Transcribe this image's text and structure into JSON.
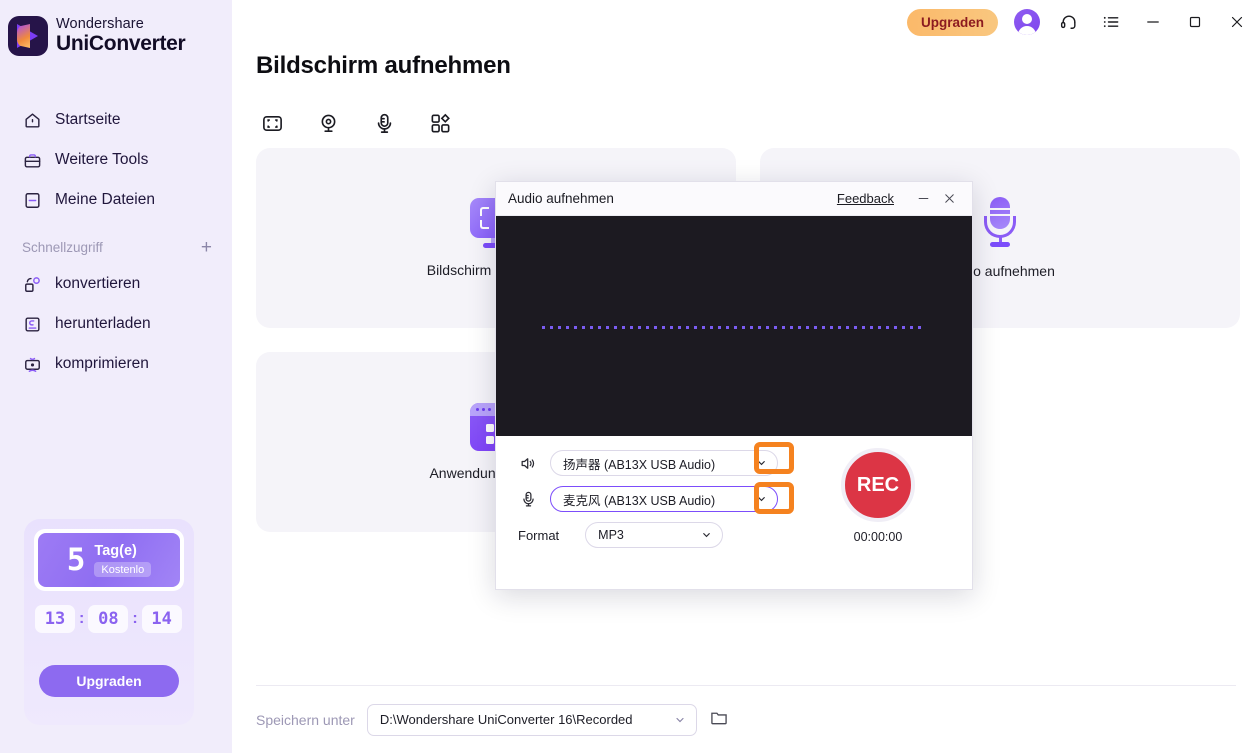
{
  "sidebar": {
    "brand": {
      "line1": "Wondershare",
      "line2": "UniConverter",
      "logo_icon": "play-logo-icon"
    },
    "items": [
      {
        "label": "Startseite",
        "icon": "home-icon"
      },
      {
        "label": "Weitere Tools",
        "icon": "toolbox-icon"
      },
      {
        "label": "Meine Dateien",
        "icon": "files-icon"
      }
    ],
    "quick_access": {
      "label": "Schnellzugriff",
      "add_icon": "plus-icon"
    },
    "quick_items": [
      {
        "label": "konvertieren",
        "icon": "convert-icon"
      },
      {
        "label": "herunterladen",
        "icon": "download-icon"
      },
      {
        "label": "komprimieren",
        "icon": "compress-icon"
      }
    ],
    "trial": {
      "days": "5",
      "days_label": "Tag(e)",
      "free_badge": "Kostenlo",
      "hours": "13",
      "minutes": "08",
      "seconds": "14",
      "sep": ":",
      "upgrade_label": "Upgraden"
    }
  },
  "titlebar": {
    "upgrade_label": "Upgraden",
    "avatar_icon": "account-avatar",
    "support_icon": "headset-icon",
    "list_icon": "task-list-icon",
    "minimize_icon": "minimize-icon",
    "maximize_icon": "maximize-icon",
    "close_icon": "close-icon"
  },
  "main": {
    "page_title": "Bildschirm aufnehmen",
    "tool_tabs": [
      {
        "icon": "screen-capture-icon"
      },
      {
        "icon": "webcam-icon"
      },
      {
        "icon": "microphone-icon"
      },
      {
        "icon": "apps-grid-icon"
      }
    ],
    "cards": [
      {
        "label": "Bildschirm aufnehmen",
        "icon": "monitor-icon"
      },
      {
        "label": "Audio aufnehmen",
        "icon": "mic-icon"
      },
      {
        "label": "Anwendungsrecorder",
        "icon": "window-grid-icon"
      }
    ],
    "save": {
      "label": "Speichern unter",
      "path": "D:\\Wondershare UniConverter 16\\Recorded",
      "folder_icon": "folder-icon",
      "chevron_icon": "chevron-down-icon"
    }
  },
  "dialog": {
    "title": "Audio aufnehmen",
    "feedback": "Feedback",
    "minimize_icon": "minimize-icon",
    "close_icon": "close-icon",
    "speaker": {
      "icon": "speaker-icon",
      "value": "扬声器 (AB13X USB Audio)",
      "chevron_icon": "chevron-down-icon"
    },
    "microphone": {
      "icon": "microphone-icon",
      "value": "麦克风 (AB13X USB Audio)",
      "chevron_icon": "chevron-down-icon"
    },
    "format": {
      "label": "Format",
      "value": "MP3",
      "chevron_icon": "chevron-down-icon"
    },
    "record": {
      "label": "REC",
      "timer": "00:00:00"
    }
  },
  "colors": {
    "accent_purple": "#7c4dfb",
    "highlight_orange": "#f5821f",
    "record_red": "#dc3545",
    "sidebar_bg": "#f1edfb",
    "card_bg": "#f5f4f9",
    "wave_bg": "#1c1a21"
  }
}
